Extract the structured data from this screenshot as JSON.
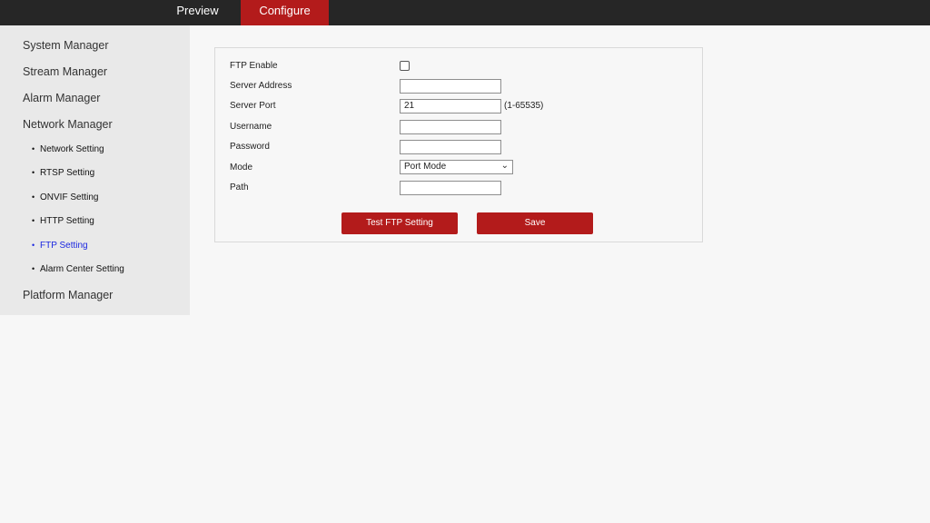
{
  "topbar": {
    "tabs": [
      {
        "label": "Preview"
      },
      {
        "label": "Configure",
        "active": true
      }
    ],
    "active_color": "#b31b1b"
  },
  "sidebar": {
    "items": [
      {
        "label": "System Manager"
      },
      {
        "label": "Stream Manager"
      },
      {
        "label": "Alarm Manager"
      },
      {
        "label": "Network Manager"
      },
      {
        "label": "Platform Manager"
      }
    ],
    "sub_items": [
      {
        "label": "Network Setting"
      },
      {
        "label": "RTSP Setting"
      },
      {
        "label": "ONVIF Setting"
      },
      {
        "label": "HTTP Setting"
      },
      {
        "label": "FTP Setting",
        "active": true
      },
      {
        "label": "Alarm Center Setting"
      }
    ],
    "bullet": "•"
  },
  "form": {
    "ftp_enable": {
      "label": "FTP Enable",
      "checked": false
    },
    "server_address": {
      "label": "Server Address",
      "value": ""
    },
    "server_port": {
      "label": "Server Port",
      "value": "21",
      "hint": "(1-65535)"
    },
    "username": {
      "label": "Username",
      "value": ""
    },
    "password": {
      "label": "Password",
      "value": ""
    },
    "mode": {
      "label": "Mode",
      "value": "Port Mode"
    },
    "path": {
      "label": "Path",
      "value": ""
    }
  },
  "buttons": {
    "test": "Test FTP Setting",
    "save": "Save"
  }
}
